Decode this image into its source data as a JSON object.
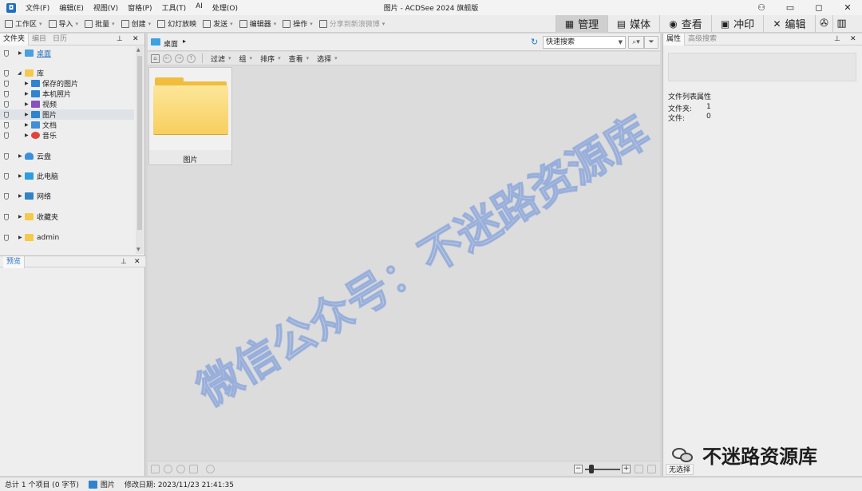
{
  "app": {
    "window_title": "图片 - ACDSee 2024 旗舰版",
    "menu": [
      "文件(F)",
      "编辑(E)",
      "视图(V)",
      "窗格(P)",
      "工具(T)",
      "AI",
      "处理(O)"
    ]
  },
  "toolbar": {
    "tools": [
      {
        "label": "工作区",
        "icon": "workspace-icon",
        "arrow": true
      },
      {
        "label": "导入",
        "icon": "import-icon",
        "arrow": true
      },
      {
        "label": "批量",
        "icon": "batch-icon",
        "arrow": true
      },
      {
        "label": "创建",
        "icon": "create-icon",
        "arrow": true
      },
      {
        "label": "幻灯放映",
        "icon": "slideshow-icon",
        "arrow": false
      },
      {
        "label": "发送",
        "icon": "send-icon",
        "arrow": true
      },
      {
        "label": "编辑器",
        "icon": "editor-icon",
        "arrow": true
      },
      {
        "label": "操作",
        "icon": "actions-icon",
        "arrow": true
      },
      {
        "label": "分享到新浪微博",
        "icon": "share-icon",
        "arrow": true,
        "disabled": true
      }
    ],
    "modes": [
      {
        "label": "管理",
        "icon": "manage-grid-icon",
        "glyph": "▦",
        "active": true
      },
      {
        "label": "媒体",
        "icon": "media-icon",
        "glyph": "▤",
        "active": false
      },
      {
        "label": "查看",
        "icon": "view-eye-icon",
        "glyph": "◉",
        "active": false
      },
      {
        "label": "冲印",
        "icon": "develop-icon",
        "glyph": "▣",
        "active": false
      },
      {
        "label": "编辑",
        "icon": "edit-tools-icon",
        "glyph": "✕",
        "active": false
      }
    ]
  },
  "left_panel": {
    "tabs": [
      "文件夹",
      "编目",
      "日历"
    ],
    "tree": [
      {
        "label": "桌面",
        "icon": "desktop-icon",
        "link": true
      },
      {
        "label": "库",
        "icon": "library-folder-icon",
        "expanded": true
      },
      {
        "label": "保存的图片",
        "icon": "saved-pictures-icon"
      },
      {
        "label": "本机照片",
        "icon": "camera-roll-icon"
      },
      {
        "label": "视频",
        "icon": "videos-icon"
      },
      {
        "label": "图片",
        "icon": "pictures-icon",
        "selected": true
      },
      {
        "label": "文档",
        "icon": "documents-icon"
      },
      {
        "label": "音乐",
        "icon": "music-icon"
      },
      {
        "label": "云盘",
        "icon": "cloud-drive-icon"
      },
      {
        "label": "此电脑",
        "icon": "this-pc-icon"
      },
      {
        "label": "网络",
        "icon": "network-icon"
      },
      {
        "label": "收藏夹",
        "icon": "favorites-folder-icon"
      },
      {
        "label": "admin",
        "icon": "user-folder-icon"
      }
    ],
    "preview_tab": "预览"
  },
  "center": {
    "location": "桌面",
    "quick_search_placeholder": "快速搜索",
    "browser_tools": [
      "过滤",
      "组",
      "排序",
      "查看",
      "选择"
    ],
    "items": [
      {
        "name": "图片",
        "type": "folder"
      }
    ]
  },
  "right_panel": {
    "tabs": [
      "属性",
      "高级搜索"
    ],
    "section_title": "文件列表属性",
    "props": [
      {
        "key": "文件夹:",
        "value": "1"
      },
      {
        "key": "文件:",
        "value": "0"
      }
    ],
    "no_selection": "无选择"
  },
  "status": {
    "total": "总计 1 个项目 (0 字节)",
    "current": "图片",
    "modified": "修改日期: 2023/11/23 21:41:35"
  },
  "watermark": {
    "diagonal": "微信公众号：不迷路资源库",
    "brand": "不迷路资源库"
  },
  "colors": {
    "accent": "#2a6fbe",
    "folder": "#f5c94c",
    "selected": "#dfe3e8"
  }
}
